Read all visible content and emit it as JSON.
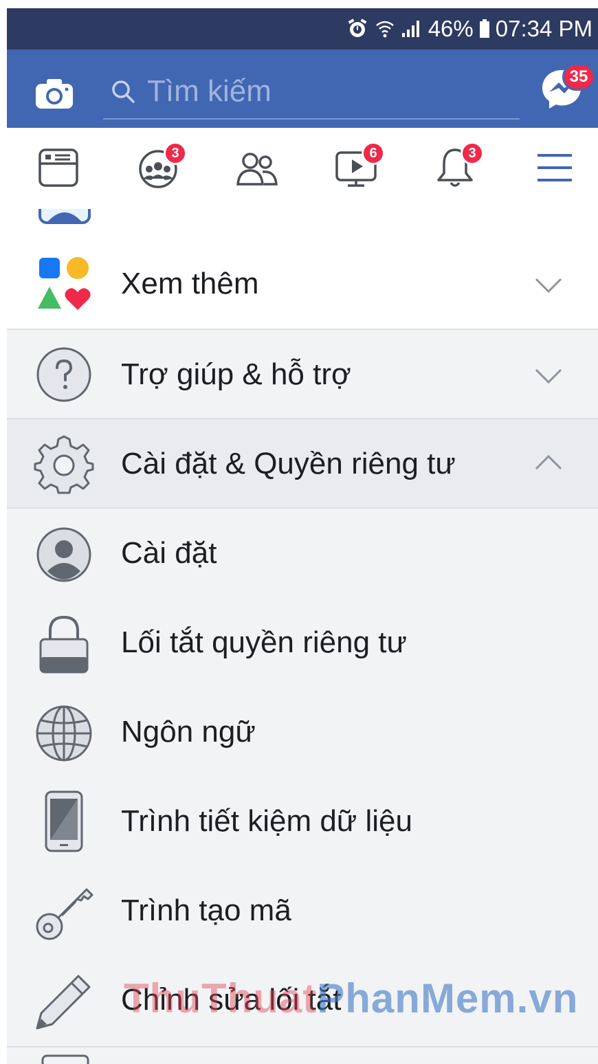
{
  "status_bar": {
    "battery": "46%",
    "time": "07:34 PM"
  },
  "header": {
    "search_placeholder": "Tìm kiếm",
    "messenger_badge": "35"
  },
  "tabs": [
    {
      "name": "news-feed-tab",
      "icon": "news-feed-icon",
      "badge": ""
    },
    {
      "name": "groups-tab",
      "icon": "groups-icon",
      "badge": "3"
    },
    {
      "name": "friends-tab",
      "icon": "friends-icon",
      "badge": ""
    },
    {
      "name": "watch-tab",
      "icon": "video-icon",
      "badge": "6"
    },
    {
      "name": "notifications-tab",
      "icon": "bell-icon",
      "badge": "3"
    },
    {
      "name": "menu-tab",
      "icon": "hamburger-menu-icon",
      "badge": ""
    }
  ],
  "menu": {
    "see_more": "Xem thêm",
    "help_support": "Trợ giúp & hỗ trợ",
    "settings_privacy": "Cài đặt & Quyền riêng tư",
    "items": [
      {
        "label": "Cài đặt",
        "icon": "user-circle-icon"
      },
      {
        "label": "Lối tắt quyền riêng tư",
        "icon": "lock-icon"
      },
      {
        "label": "Ngôn ngữ",
        "icon": "globe-icon"
      },
      {
        "label": "Trình tiết kiệm dữ liệu",
        "icon": "phone-icon"
      },
      {
        "label": "Trình tạo mã",
        "icon": "key-icon"
      },
      {
        "label": "Chỉnh sửa lối tắt",
        "icon": "pencil-icon"
      }
    ]
  },
  "watermark": {
    "part1": "ThuThuat",
    "part2": "PhanMem.vn"
  },
  "colors": {
    "brand": "#4267b2",
    "status_bar": "#2d3a61",
    "badge": "#f02849",
    "list_bg": "#f2f3f5"
  }
}
